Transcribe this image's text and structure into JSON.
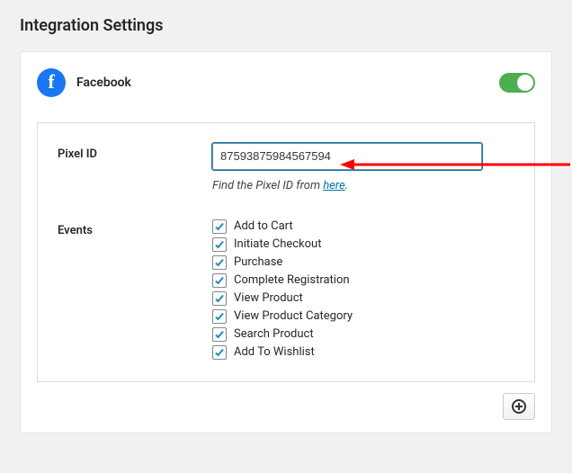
{
  "page": {
    "title": "Integration Settings"
  },
  "panel": {
    "name": "Facebook",
    "enabled": true
  },
  "pixel": {
    "label": "Pixel ID",
    "value": "87593875984567594",
    "help_prefix": "Find the Pixel ID from ",
    "help_link_text": "here",
    "help_suffix": "."
  },
  "events": {
    "label": "Events",
    "items": [
      {
        "label": "Add to Cart",
        "checked": true
      },
      {
        "label": "Initiate Checkout",
        "checked": true
      },
      {
        "label": "Purchase",
        "checked": true
      },
      {
        "label": "Complete Registration",
        "checked": true
      },
      {
        "label": "View Product",
        "checked": true
      },
      {
        "label": "View Product Category",
        "checked": true
      },
      {
        "label": "Search Product",
        "checked": true
      },
      {
        "label": "Add To Wishlist",
        "checked": true
      }
    ]
  }
}
